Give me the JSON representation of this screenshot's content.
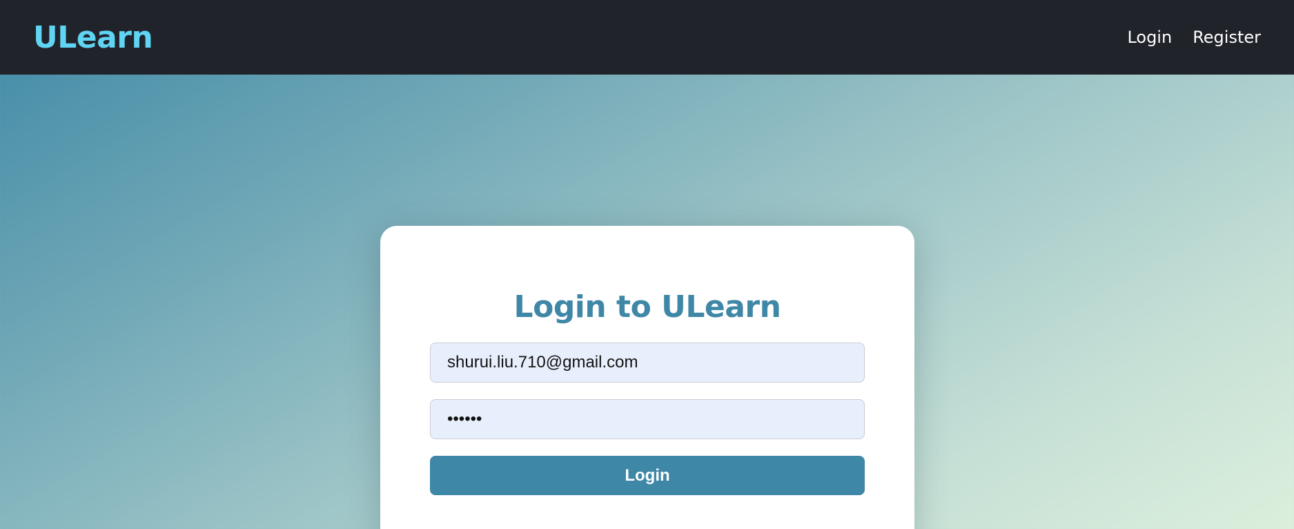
{
  "header": {
    "brand": "ULearn",
    "nav": [
      {
        "label": "Login"
      },
      {
        "label": "Register"
      }
    ]
  },
  "login": {
    "title": "Login to ULearn",
    "email_value": "shurui.liu.710@gmail.com",
    "password_value": "••••••",
    "submit_label": "Login"
  },
  "colors": {
    "navbar_bg": "#21232b",
    "brand": "#5fd4f3",
    "accent": "#3e87a6",
    "input_bg": "#e8effc"
  }
}
